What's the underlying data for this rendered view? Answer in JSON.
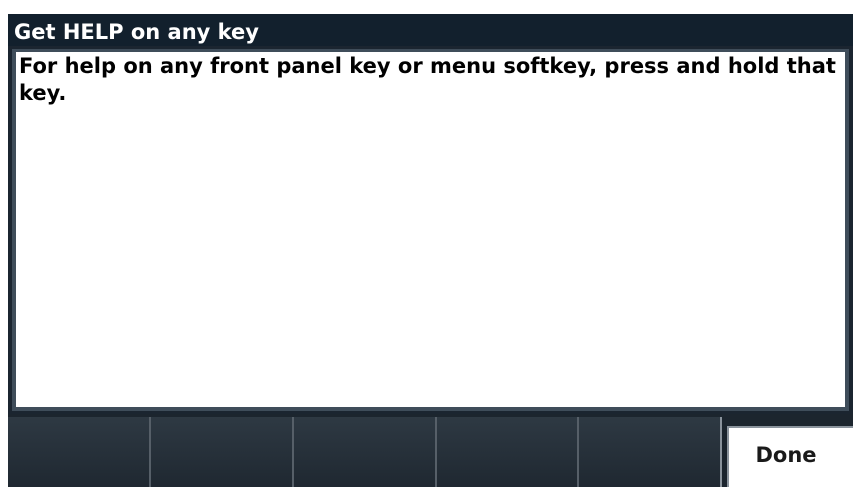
{
  "dialog": {
    "title": "Get HELP on any key",
    "body": "For help on any front panel key or menu softkey, press and hold that key."
  },
  "softkeys": {
    "done_label": "Done"
  },
  "colors": {
    "title_bar": "#12202d",
    "panel_frame": "#3f4d5a",
    "softkey_bar": "#1c252e",
    "text": "#000000",
    "title_text": "#ffffff"
  }
}
